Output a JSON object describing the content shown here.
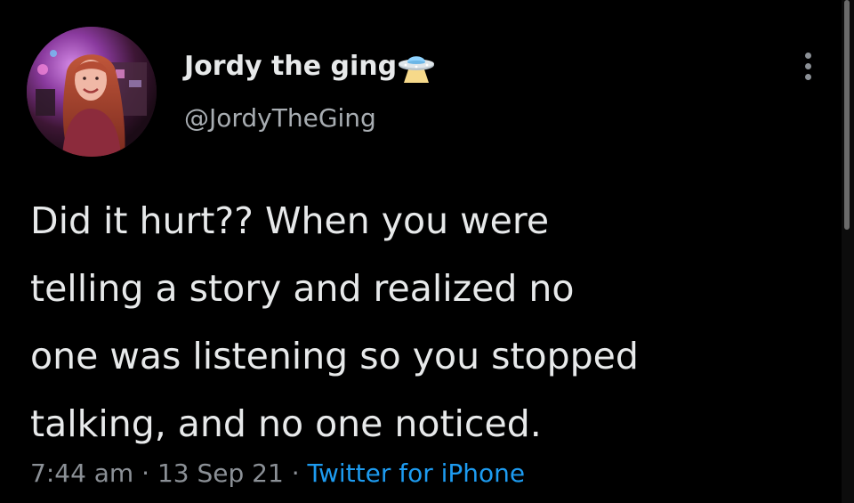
{
  "user": {
    "display_name": "Jordy the ging",
    "name_emoji_icon": "ufo-icon",
    "handle": "@JordyTheGing",
    "avatar_icon": "profile-photo"
  },
  "tweet": {
    "text_lines": [
      "Did it hurt?? When you were",
      "telling a story and realized no",
      "one was listening so you stopped",
      "talking, and no one noticed."
    ],
    "time": "7:44 am",
    "date": "13 Sep 21",
    "separator": "·",
    "source": "Twitter for iPhone"
  },
  "menu": {
    "more_icon": "more-vertical-icon"
  },
  "colors": {
    "background": "#000000",
    "text": "#e7e9ea",
    "secondary": "#8b9096",
    "link": "#1d9bf0"
  }
}
